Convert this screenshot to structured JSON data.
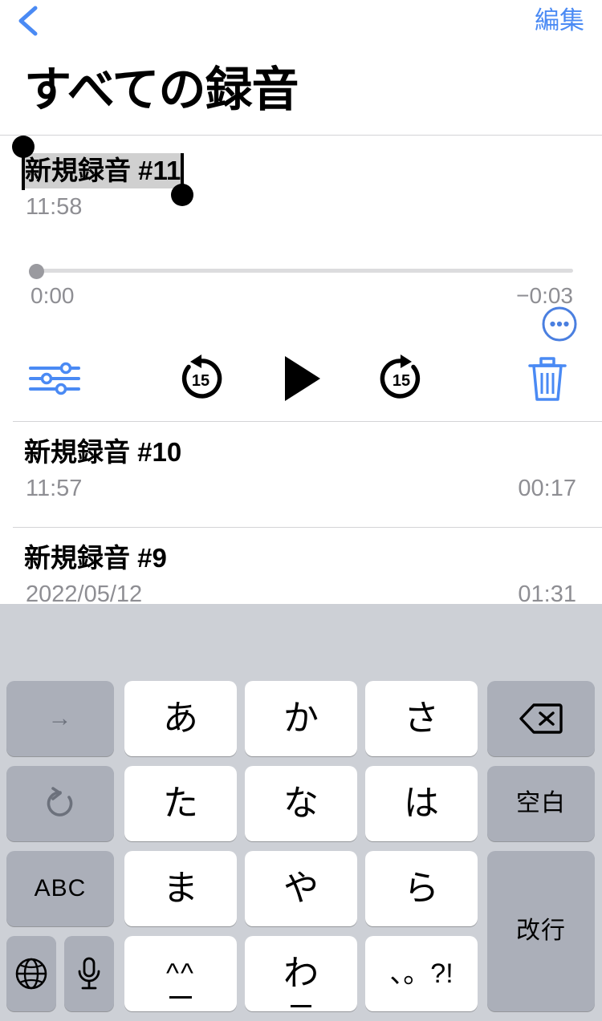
{
  "nav": {
    "back_icon": "chevron-left-icon",
    "edit_label": "編集"
  },
  "header": {
    "title": "すべての録音"
  },
  "colors": {
    "accent_blue": "#4a8af4",
    "more_button_blue": "#4a7fe0",
    "secondary_text": "#8e8e93",
    "selection_highlight": "#d0d0d0",
    "keyboard_bg": "#cdd0d6",
    "key_dark": "#abafb9",
    "key_light": "#ffffff"
  },
  "expanded_recording": {
    "title": "新規録音 #11",
    "time": "11:58",
    "more_icon": "ellipsis-circle-icon",
    "is_editing_title": true,
    "scrubber": {
      "position_label": "0:00",
      "remaining_label": "−0:03",
      "progress_percent": 0
    },
    "controls": [
      {
        "name": "edit-recording-button",
        "icon": "sliders-icon",
        "color": "#4a8af4"
      },
      {
        "name": "skip-back-15-button",
        "icon": "skip-back-15-icon",
        "label": "15",
        "color": "#000000"
      },
      {
        "name": "play-button",
        "icon": "play-icon",
        "color": "#000000"
      },
      {
        "name": "skip-forward-15-button",
        "icon": "skip-forward-15-icon",
        "label": "15",
        "color": "#000000"
      },
      {
        "name": "delete-button",
        "icon": "trash-icon",
        "color": "#4a8af4"
      }
    ]
  },
  "recordings": [
    {
      "title": "新規録音 #10",
      "date": "11:57",
      "duration": "00:17"
    },
    {
      "title": "新規録音 #9",
      "date": "2022/05/12",
      "duration": "01:31"
    }
  ],
  "keyboard": {
    "type": "japanese-kana-10key",
    "suggestions": [],
    "keys": {
      "arrow_right": "→",
      "undo": "↺",
      "abc": "ABC",
      "globe": "globe-icon",
      "mic": "microphone-icon",
      "a": "あ",
      "ka": "か",
      "sa": "さ",
      "ta": "た",
      "na": "な",
      "ha": "は",
      "ma": "ま",
      "ya": "や",
      "ra": "ら",
      "kaomoji": "^^",
      "wa": "わ",
      "punctuation": "、。?!",
      "delete": "delete-icon",
      "space": "空白",
      "return": "改行"
    }
  }
}
